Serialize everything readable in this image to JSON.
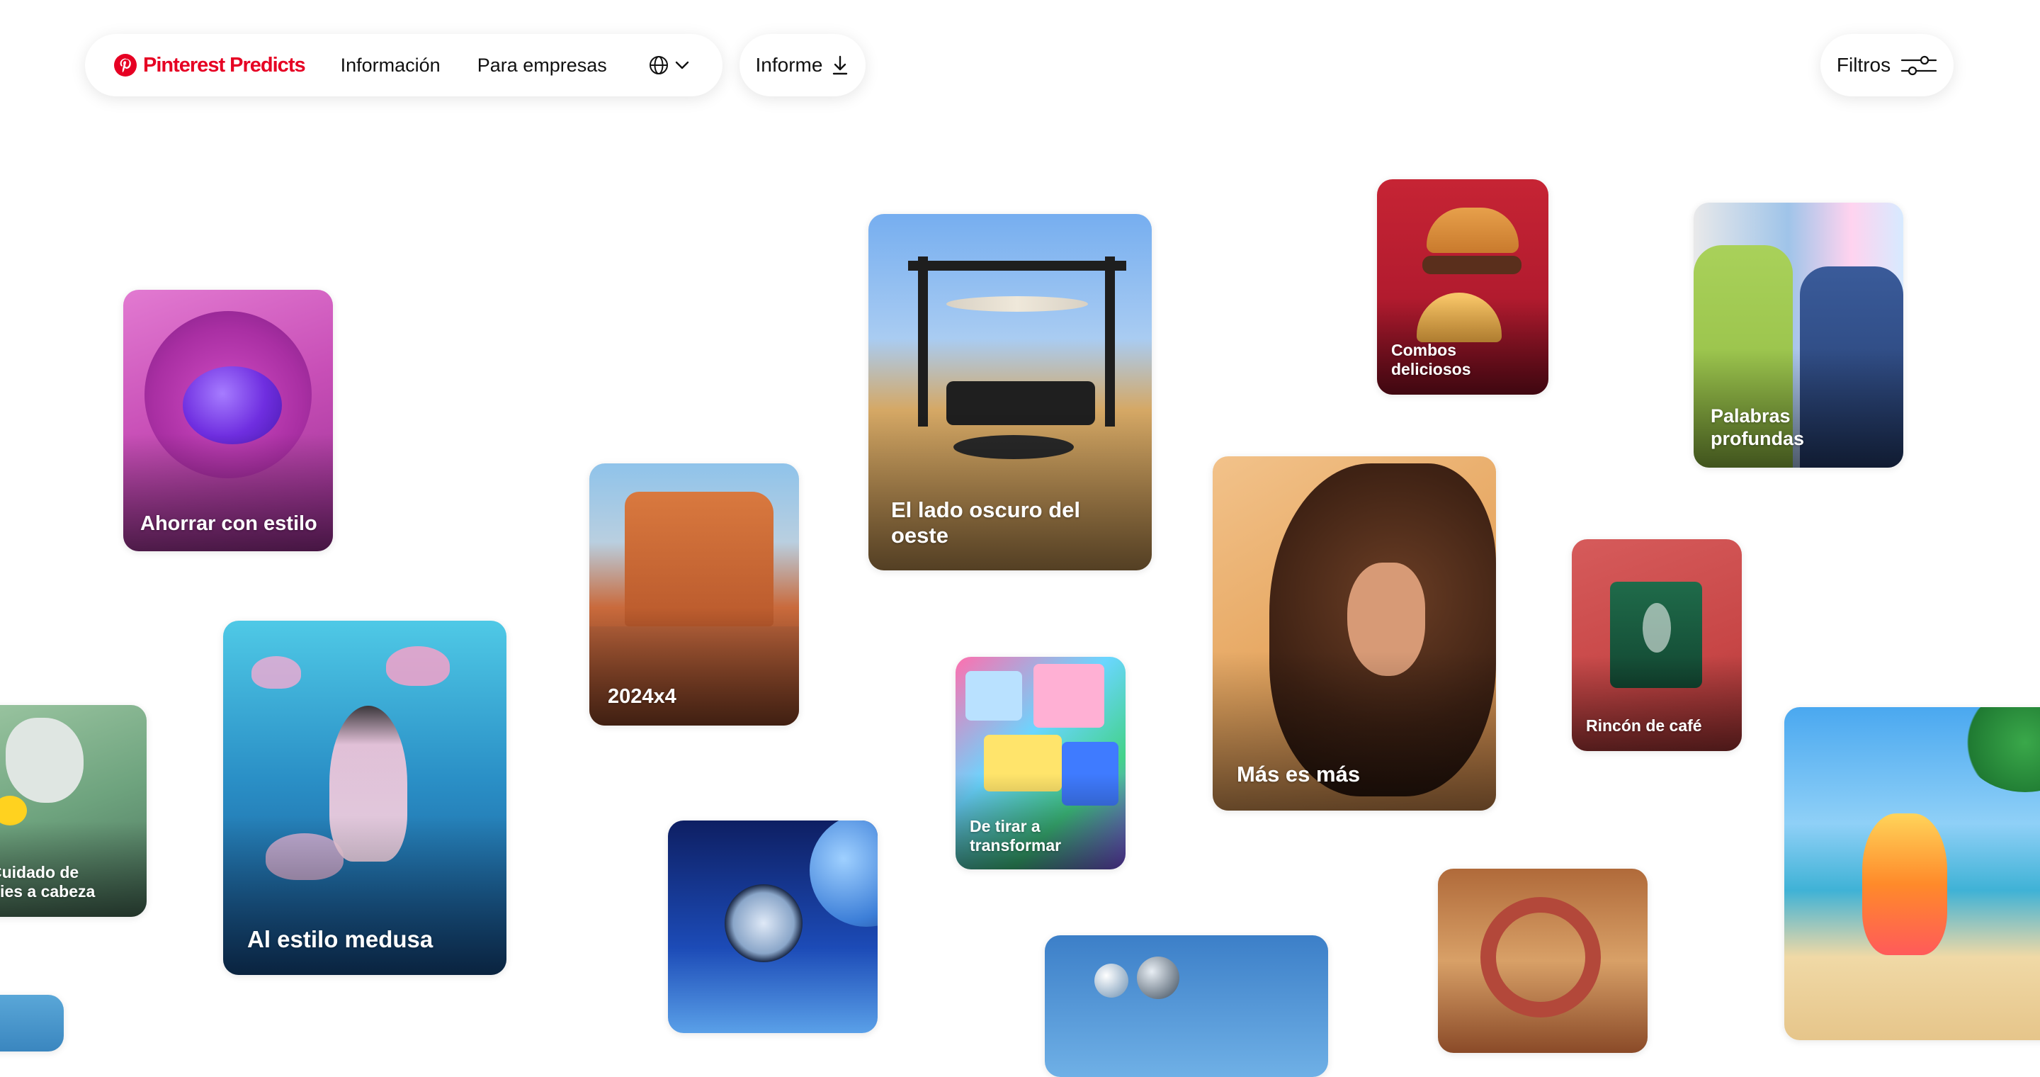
{
  "nav": {
    "brand": "Pinterest Predicts",
    "links": [
      "Información",
      "Para empresas"
    ],
    "report_label": "Informe",
    "filters_label": "Filtros"
  },
  "colors": {
    "brand": "#e60023",
    "background": "#ffffff"
  },
  "icons": {
    "brand": "pinterest-logo-icon",
    "language": "globe-icon",
    "language_caret": "chevron-down-icon",
    "report": "download-icon",
    "filters": "sliders-icon"
  },
  "trends": [
    {
      "id": "ahorrar",
      "title": "Ahorrar con estilo"
    },
    {
      "id": "medusa",
      "title": "Al estilo medusa"
    },
    {
      "id": "cuidado",
      "title": "Cuidado de pies a cabeza"
    },
    {
      "id": "2024",
      "title": "2024x4"
    },
    {
      "id": "oeste",
      "title": "El lado oscuro del oeste"
    },
    {
      "id": "tirar",
      "title": "De tirar a transformar"
    },
    {
      "id": "combos",
      "title": "Combos deliciosos"
    },
    {
      "id": "mas",
      "title": "Más es más"
    },
    {
      "id": "palabras",
      "title": "Palabras profundas"
    },
    {
      "id": "rincon",
      "title": "Rincón de café"
    }
  ]
}
